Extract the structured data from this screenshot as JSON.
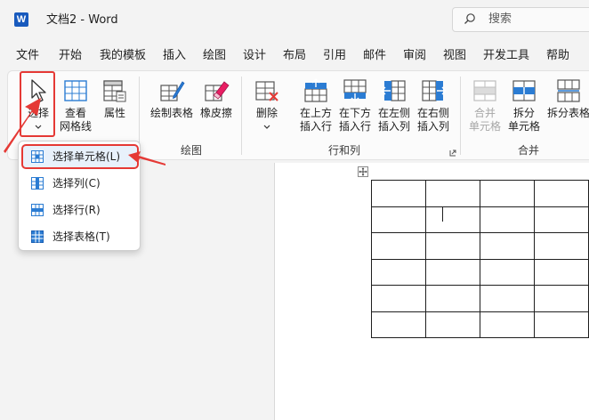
{
  "window": {
    "doc_title": "文档2 - Word",
    "search_placeholder": "搜索"
  },
  "menu": {
    "items": [
      "文件",
      "开始",
      "我的模板",
      "插入",
      "绘图",
      "设计",
      "布局",
      "引用",
      "邮件",
      "审阅",
      "视图",
      "开发工具",
      "帮助"
    ]
  },
  "ribbon": {
    "select_label": "选择",
    "gridlines_label_1": "查看",
    "gridlines_label_2": "网格线",
    "properties_label": "属性",
    "draw_table_label": "绘制表格",
    "eraser_label": "橡皮擦",
    "delete_label": "删除",
    "insert_above_1": "在上方",
    "insert_above_2": "插入行",
    "insert_below_1": "在下方",
    "insert_below_2": "插入行",
    "insert_left_1": "在左侧",
    "insert_left_2": "插入列",
    "insert_right_1": "在右侧",
    "insert_right_2": "插入列",
    "merge_cells_1": "合并",
    "merge_cells_2": "单元格",
    "split_cells_1": "拆分",
    "split_cells_2": "单元格",
    "split_table_label": "拆分表格",
    "group_draw": "绘图",
    "group_rows_cols": "行和列",
    "group_merge": "合并"
  },
  "select_dropdown": {
    "items": [
      "选择单元格(L)",
      "选择列(C)",
      "选择行(R)",
      "选择表格(T)"
    ],
    "active_index": 0
  },
  "document": {
    "table_rows": 6,
    "table_cols": 4
  },
  "colors": {
    "accent": "#185abd",
    "highlight": "#e53935",
    "icon_blue": "#2b7cd3"
  }
}
